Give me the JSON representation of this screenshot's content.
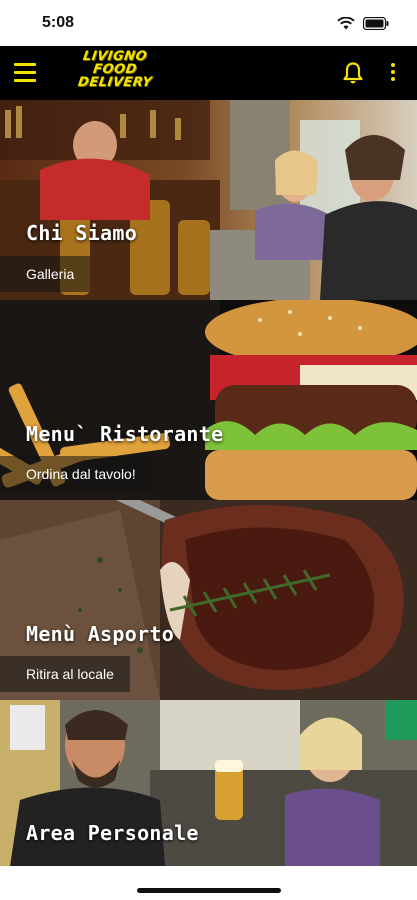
{
  "status_bar": {
    "time": "5:08"
  },
  "app_bar": {
    "logo_lines": [
      "LIVIGNO",
      "FOOD",
      "DELIVERY"
    ],
    "accent_color": "#f3e300",
    "background": "#000000",
    "icons": [
      "menu-icon",
      "bell-icon",
      "more-vert-icon"
    ]
  },
  "tiles": [
    {
      "title": "Chi Siamo",
      "subtitle": "Galleria"
    },
    {
      "title": "Menu` Ristorante",
      "subtitle": "Ordina dal tavolo!"
    },
    {
      "title": "Menù Asporto",
      "subtitle": "Ritira al locale"
    },
    {
      "title": "Area Personale",
      "subtitle": ""
    }
  ]
}
